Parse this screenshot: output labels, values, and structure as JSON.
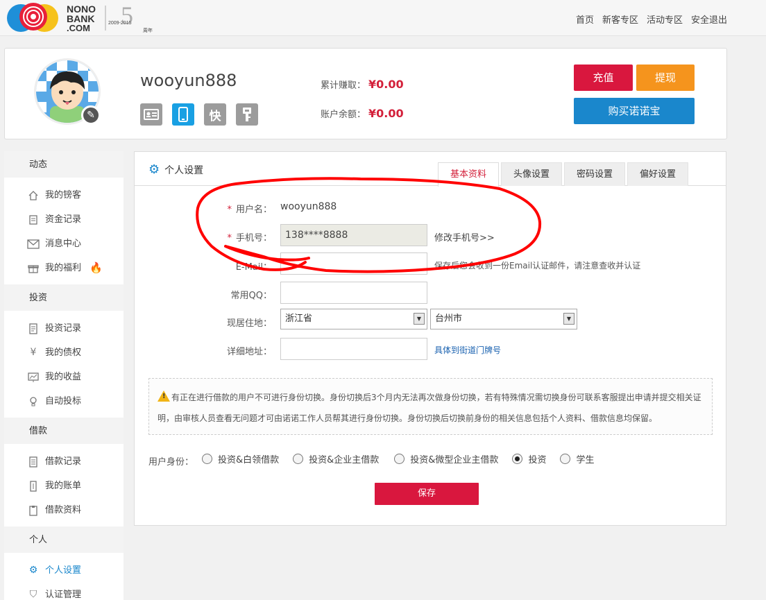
{
  "header": {
    "logo_top": "NONO",
    "logo_mid": "BANK",
    "logo_bottom": ".COM",
    "anniv_years": "2009-2015",
    "anniv_number": "5",
    "anniv_suffix": "周年",
    "nav": [
      "首页",
      "新客专区",
      "活动专区",
      "安全退出"
    ]
  },
  "profile": {
    "username": "wooyun888",
    "total_earned_label": "累计赚取：",
    "total_earned_value": "¥0.00",
    "balance_label": "账户余额：",
    "balance_value": "¥0.00",
    "quick_icon_text": "快",
    "recharge": "充值",
    "withdraw": "提现",
    "buy": "购买诺诺宝"
  },
  "sidebar": {
    "sections": [
      {
        "title": "动态",
        "items": [
          {
            "label": "我的镑客",
            "icon": "home-icon"
          },
          {
            "label": "资金记录",
            "icon": "ledger-icon"
          },
          {
            "label": "消息中心",
            "icon": "mail-icon"
          },
          {
            "label": "我的福利",
            "icon": "gift-icon"
          }
        ]
      },
      {
        "title": "投资",
        "items": [
          {
            "label": "投资记录",
            "icon": "document-icon"
          },
          {
            "label": "我的债权",
            "icon": "yen-tag-icon"
          },
          {
            "label": "我的收益",
            "icon": "chart-icon"
          },
          {
            "label": "自动投标",
            "icon": "bulb-icon"
          }
        ]
      },
      {
        "title": "借款",
        "items": [
          {
            "label": "借款记录",
            "icon": "list-icon"
          },
          {
            "label": "我的账单",
            "icon": "bill-icon"
          },
          {
            "label": "借款资料",
            "icon": "clipboard-icon"
          }
        ]
      },
      {
        "title": "个人",
        "items": [
          {
            "label": "个人设置",
            "icon": "gear-icon"
          },
          {
            "label": "认证管理",
            "icon": "shield-icon"
          }
        ]
      }
    ]
  },
  "panel": {
    "title": "个人设置",
    "tabs": [
      "基本资料",
      "头像设置",
      "密码设置",
      "偏好设置"
    ],
    "form": {
      "username_label": "用户名：",
      "username_value": "wooyun888",
      "phone_label": "手机号：",
      "phone_value": "138****8888",
      "phone_link": "修改手机号>>",
      "email_label": "E-Mail：",
      "email_hint": "保存后您会收到一份Email认证邮件，请注意查收并认证",
      "qq_label": "常用QQ：",
      "residence_label": "现居住地：",
      "province": "浙江省",
      "city": "台州市",
      "address_label": "详细地址：",
      "address_hint": "具体到街道门牌号",
      "required_mark": "*"
    },
    "notice_line1": "有正在进行借款的用户不可进行身份切换。身份切换后3个月内无法再次做身份切换，若有特殊情况需切换身份可联系客服提出申请并提交相关证",
    "notice_line2": "明，由审核人员查看无问题才可由诺诺工作人员帮其进行身份切换。身份切换后切换前身份的相关信息包括个人资料、借款信息均保留。",
    "identity_label": "用户身份：",
    "identity_options": [
      "投资&白领借款",
      "投资&企业主借款",
      "投资&微型企业主借款",
      "投资",
      "学生"
    ],
    "identity_selected": "投资",
    "save": "保存"
  },
  "colors": {
    "accent_red": "#d9173e",
    "accent_orange": "#f5941d",
    "accent_blue": "#1a87cc",
    "scribble": "#ff0000"
  }
}
